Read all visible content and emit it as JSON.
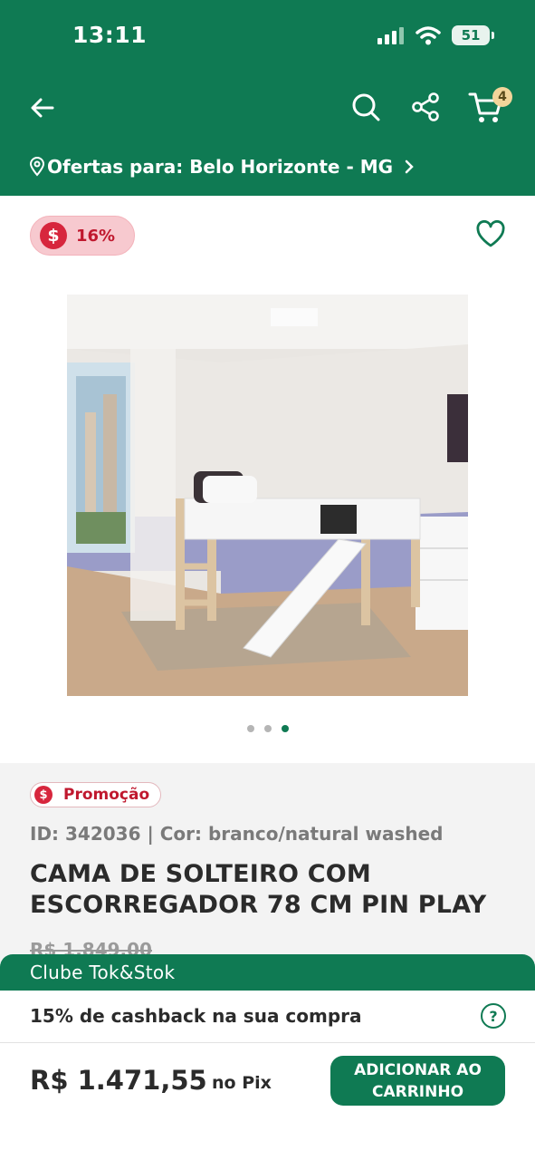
{
  "status_bar": {
    "time": "13:11",
    "battery": "51"
  },
  "header": {
    "icons": [
      "back-arrow-icon",
      "search-icon",
      "share-icon",
      "cart-icon"
    ],
    "cart_count": "4",
    "location_text": "Ofertas para: Belo Horizonte - MG",
    "brand_color": "#0f7a53"
  },
  "product": {
    "discount_symbol": "$",
    "discount": "16%",
    "promo_symbol": "$",
    "promo_label": "Promoção",
    "id_line": "ID: 342036 | Cor: branco/natural washed",
    "title": "CAMA DE SOLTEIRO COM ESCORREGADOR 78 CM PIN PLAY",
    "old_price": "R$ 1.849,00",
    "image_dots": {
      "count": 3,
      "active_index": 2
    }
  },
  "club": {
    "label": "Clube Tok&Stok",
    "cashback_text": "15% de cashback na sua compra",
    "help_symbol": "?"
  },
  "footer": {
    "price": "R$ 1.471,55",
    "pix_label": "no Pix",
    "add_button_label": "ADICIONAR AO CARRINHO"
  }
}
